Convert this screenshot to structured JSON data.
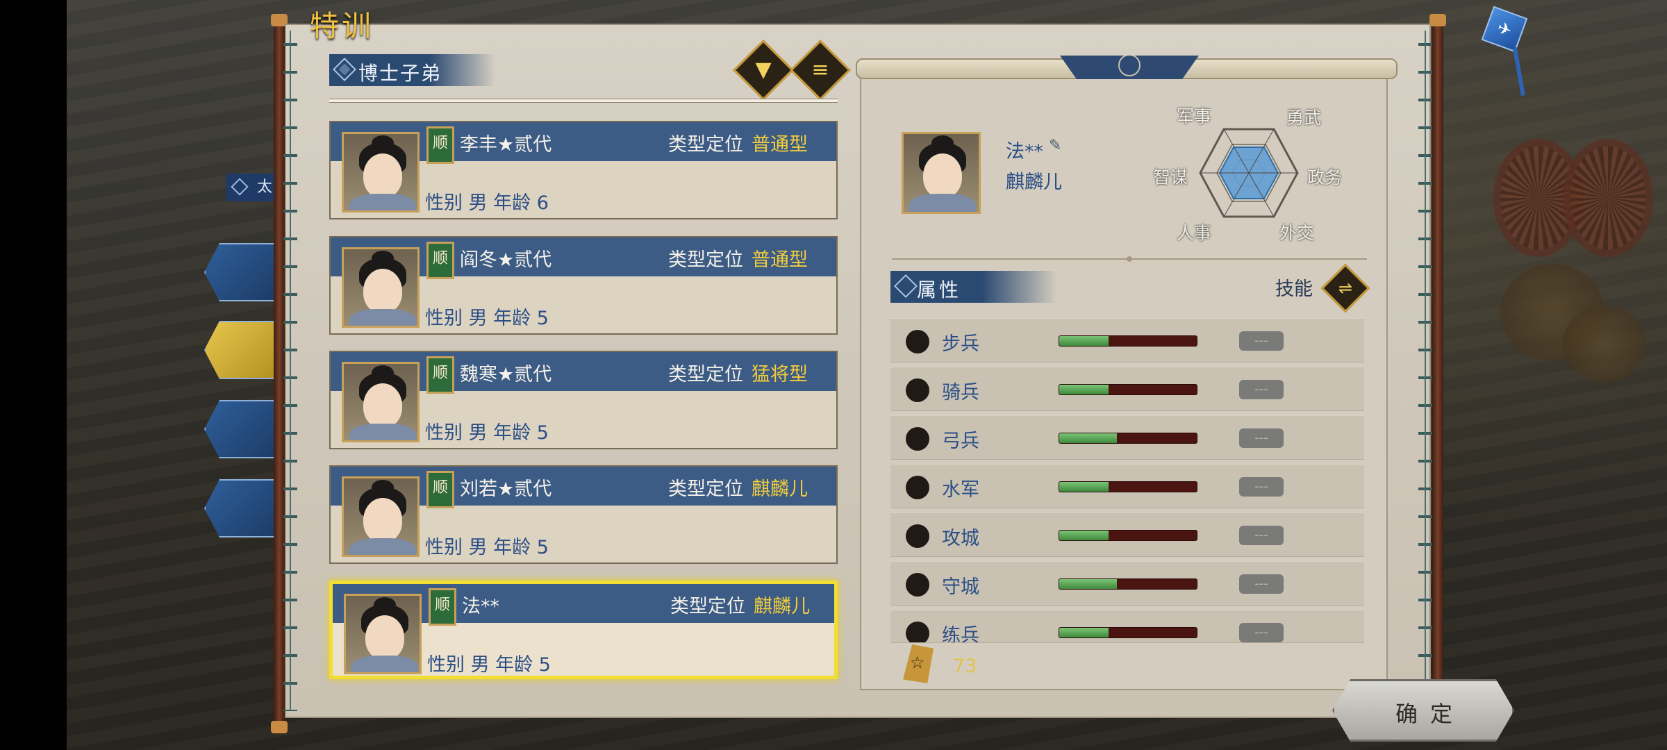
{
  "screen_title": "特训",
  "side_label": "太",
  "list_header": "博士子弟",
  "filter_icon": "filter-icon",
  "sort_icon": "list-icon",
  "cards": [
    {
      "tag": "顺",
      "name": "李丰★贰代",
      "type_label": "类型定位",
      "type_value": "普通型",
      "meta": "性别 男  年龄 6",
      "selected": false
    },
    {
      "tag": "顺",
      "name": "阎冬★贰代",
      "type_label": "类型定位",
      "type_value": "普通型",
      "meta": "性别 男  年龄 5",
      "selected": false
    },
    {
      "tag": "顺",
      "name": "魏寒★贰代",
      "type_label": "类型定位",
      "type_value": "猛将型",
      "meta": "性别 男  年龄 5",
      "selected": false
    },
    {
      "tag": "顺",
      "name": "刘若★贰代",
      "type_label": "类型定位",
      "type_value": "麒麟儿",
      "meta": "性别 男  年龄 5",
      "selected": false
    },
    {
      "tag": "顺",
      "name": "法**",
      "type_label": "类型定位",
      "type_value": "麒麟儿",
      "meta": "性别 男  年龄 5",
      "selected": true
    }
  ],
  "detail": {
    "name": "法**",
    "type": "麒麟儿",
    "hex_stats": {
      "military": "军事",
      "valor": "勇武",
      "strategy": "智谋",
      "politics": "政务",
      "personnel": "人事",
      "diplomacy": "外交"
    },
    "attr_header": "属性",
    "skill_label": "技能",
    "attributes": [
      {
        "label": "步兵",
        "level": 0.36,
        "grade": "---"
      },
      {
        "label": "骑兵",
        "level": 0.36,
        "grade": "---"
      },
      {
        "label": "弓兵",
        "level": 0.42,
        "grade": "---"
      },
      {
        "label": "水军",
        "level": 0.36,
        "grade": "---"
      },
      {
        "label": "攻城",
        "level": 0.36,
        "grade": "---"
      },
      {
        "label": "守城",
        "level": 0.42,
        "grade": "---"
      },
      {
        "label": "练兵",
        "level": 0.36,
        "grade": "---"
      }
    ],
    "coin_value": "73"
  },
  "confirm_label": "确定",
  "colors": {
    "accent_gold": "#f2cd3c",
    "bar_blue": "#3d5c85",
    "label_blue": "#2a4e86",
    "selected_border": "#f2dd33"
  }
}
